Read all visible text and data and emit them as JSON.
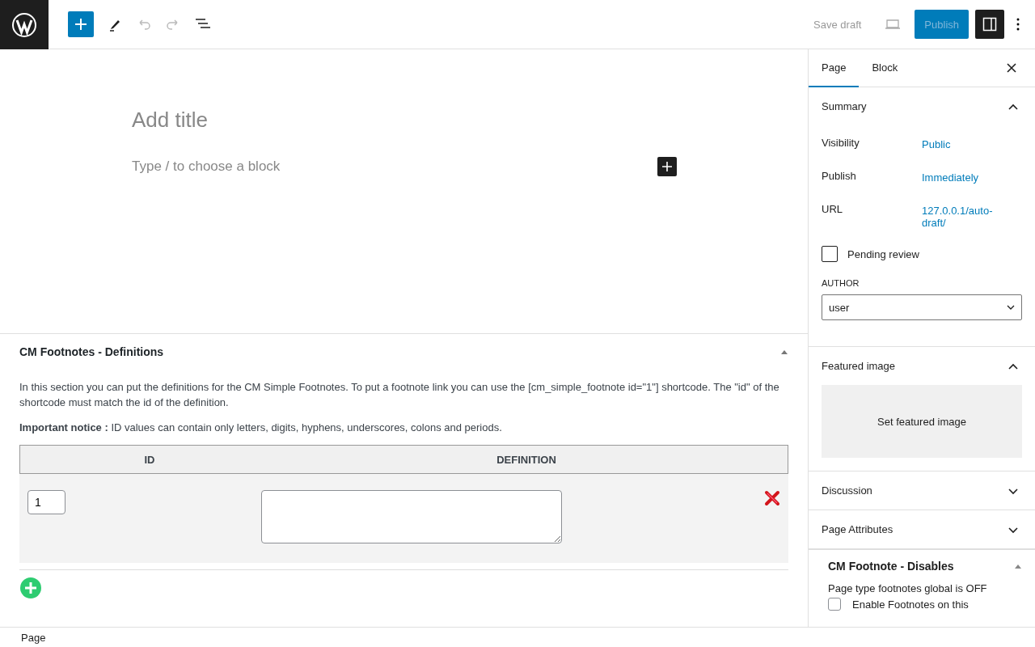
{
  "toolbar": {
    "save_draft": "Save draft",
    "publish": "Publish",
    "settings_open": true
  },
  "editor": {
    "title_placeholder": "Add title",
    "block_placeholder": "Type / to choose a block"
  },
  "definitions_box": {
    "title": "CM Footnotes - Definitions",
    "expanded": true,
    "description": "In this section you can put the definitions for the CM Simple Footnotes. To put a footnote link you can use the [cm_simple_footnote id=\"1\"] shortcode. The \"id\" of the shortcode must match the id of the definition.",
    "notice": "**Important notice :** ID values can contain only letters, digits, hyphens, underscores, colons and periods.",
    "columns": [
      "ID",
      "DEFINITION"
    ],
    "rows": [
      {
        "id": "1"
      }
    ]
  },
  "sidebar": {
    "tabs": [
      {
        "label": "Page",
        "selected": true
      },
      {
        "label": "Block",
        "selected": false
      }
    ],
    "panels": [
      {
        "kind": "summary",
        "title": "Summary",
        "expanded": true,
        "fields": [
          {
            "label": "Visibility",
            "value": "Public"
          },
          {
            "label": "Publish",
            "value": "Immediately"
          },
          {
            "label": "URL",
            "value": "127.0.0.1/auto-draft/"
          }
        ],
        "pending_review": {
          "label": "Pending review",
          "checked": false
        },
        "author": {
          "label": "AUTHOR",
          "value": "user"
        }
      },
      {
        "kind": "featured",
        "title": "Featured image",
        "expanded": true,
        "button": "Set featured image"
      },
      {
        "title": "Discussion",
        "expanded": false
      },
      {
        "title": "Page Attributes",
        "expanded": false
      }
    ],
    "meta_box": {
      "title": "CM Footnote - Disables",
      "expanded": true,
      "status": "Page type footnotes global is OFF",
      "checkbox": {
        "label": "Enable Footnotes on this",
        "checked": false
      }
    }
  },
  "footer": {
    "breadcrumb": "Page"
  }
}
